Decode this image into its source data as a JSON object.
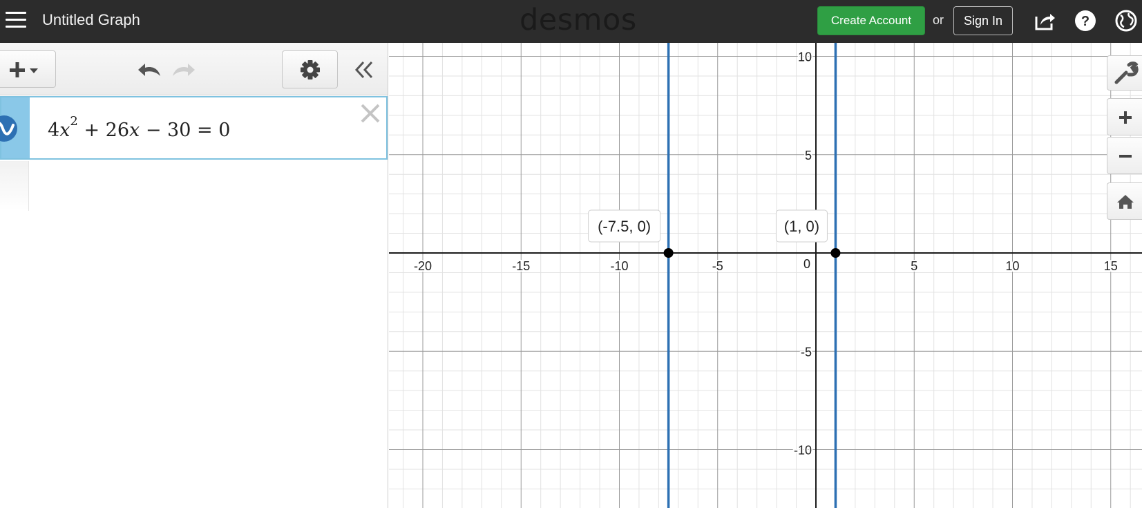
{
  "header": {
    "title": "Untitled Graph",
    "logo": "desmos",
    "create_account": "Create Account",
    "or": "or",
    "sign_in": "Sign In",
    "icons": [
      "menu-icon",
      "share-icon",
      "help-icon",
      "globe-icon"
    ]
  },
  "toolbar": {
    "icons": [
      "add-icon",
      "undo-icon",
      "redo-icon",
      "gear-icon",
      "collapse-icon"
    ]
  },
  "expression": {
    "c1": "4",
    "v1": "x",
    "exp": "2",
    "op1": " + 26",
    "v2": "x",
    "op2": " − 30 = 0",
    "icon": "wave-icon"
  },
  "graph": {
    "x_ticks": [
      "-20",
      "-15",
      "-10",
      "-5",
      "0",
      "5",
      "10",
      "15"
    ],
    "y_ticks": [
      "10",
      "5",
      "-5",
      "-10"
    ],
    "points": [
      {
        "x": -7.5,
        "y": 0,
        "label": "(-7.5, 0)"
      },
      {
        "x": 1,
        "y": 0,
        "label": "(1, 0)"
      }
    ],
    "vertical_lines": [
      -7.5,
      1
    ],
    "curve_color": "#2d70b3"
  },
  "side_tools": [
    "wrench-icon",
    "zoom-in-icon",
    "zoom-out-icon",
    "home-icon"
  ]
}
